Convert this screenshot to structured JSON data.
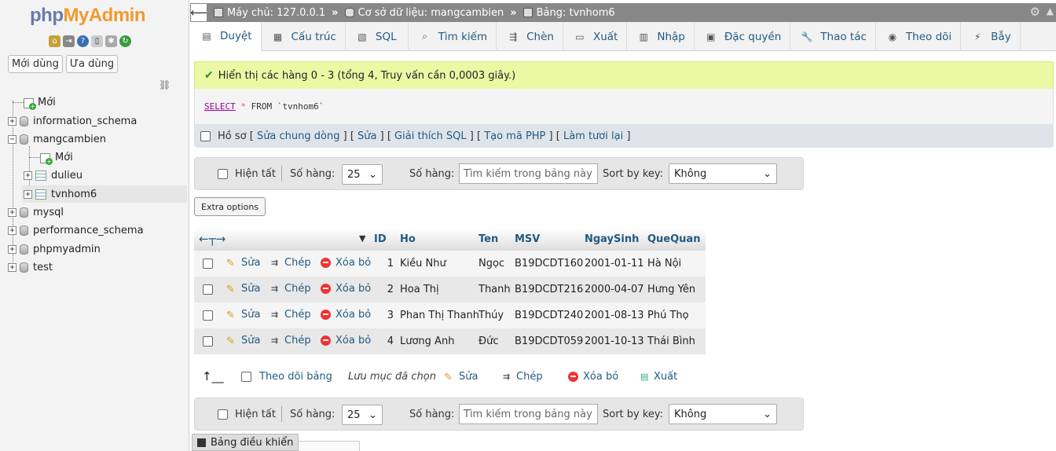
{
  "sidebar": {
    "logo_part1": "php",
    "logo_part2": "MyAdmin",
    "quick_icons": [
      "home-icon",
      "exit-icon",
      "help-icon",
      "docs-icon",
      "settings-icon",
      "reload-icon"
    ],
    "recent_label": "Mới dùng",
    "favorite_label": "Ưa dùng",
    "tree": {
      "new": "Mới",
      "dbs": [
        "information_schema",
        "mangcambien",
        "mysql",
        "performance_schema",
        "phpmyadmin",
        "test"
      ],
      "child_new": "Mới",
      "tables": [
        "dulieu",
        "tvnhom6"
      ]
    }
  },
  "breadcrumb": {
    "server": "Máy chủ: 127.0.0.1",
    "database": "Cơ sở dữ liệu: mangcambien",
    "table": "Bảng: tvnhom6"
  },
  "tabs": [
    {
      "label": "Duyệt",
      "icon": "browse-icon"
    },
    {
      "label": "Cấu trúc",
      "icon": "structure-icon"
    },
    {
      "label": "SQL",
      "icon": "sql-icon"
    },
    {
      "label": "Tìm kiếm",
      "icon": "search-icon"
    },
    {
      "label": "Chèn",
      "icon": "insert-icon"
    },
    {
      "label": "Xuất",
      "icon": "export-icon"
    },
    {
      "label": "Nhập",
      "icon": "import-icon"
    },
    {
      "label": "Đặc quyền",
      "icon": "privileges-icon"
    },
    {
      "label": "Thao tác",
      "icon": "operations-icon"
    },
    {
      "label": "Theo dõi",
      "icon": "tracking-icon"
    },
    {
      "label": "Bẫy",
      "icon": "triggers-icon"
    }
  ],
  "message": "Hiển thị các hàng 0 - 3 (tổng 4, Truy vấn cần 0,0003 giây.)",
  "sql": {
    "kw": "SELECT",
    "star": "*",
    "from": "FROM",
    "table": "`tvnhom6`"
  },
  "profiling": {
    "label": "Hồ sơ",
    "links": [
      "Sửa chung dòng",
      "Sửa",
      "Giải thích SQL",
      "Tạo mã PHP",
      "Làm tươi lại"
    ]
  },
  "nav": {
    "show_all": "Hiện tất",
    "rows_label": "Số hàng:",
    "rows_value": "25",
    "filter_label": "Số hàng:",
    "filter_placeholder": "Tìm kiếm trong bảng này",
    "sort_label": "Sort by key:",
    "sort_value": "Không"
  },
  "extra_options": "Extra options",
  "table": {
    "columns": [
      "ID",
      "Ho",
      "Ten",
      "MSV",
      "NgaySinh",
      "QueQuan"
    ],
    "actions": {
      "edit": "Sửa",
      "copy": "Chép",
      "delete": "Xóa bỏ"
    },
    "rows": [
      {
        "ID": "1",
        "Ho": "Kiều Như",
        "Ten": "Ngọc",
        "MSV": "B19DCDT160",
        "NgaySinh": "2001-01-11",
        "QueQuan": "Hà Nội"
      },
      {
        "ID": "2",
        "Ho": "Hoa Thị",
        "Ten": "Thanh",
        "MSV": "B19DCDT216",
        "NgaySinh": "2000-04-07",
        "QueQuan": "Hưng Yên"
      },
      {
        "ID": "3",
        "Ho": "Phan Thị Thanh",
        "Ten": "Thúy",
        "MSV": "B19DCDT240",
        "NgaySinh": "2001-08-13",
        "QueQuan": "Phú Thọ"
      },
      {
        "ID": "4",
        "Ho": "Lương Anh",
        "Ten": "Đức",
        "MSV": "B19DCDT059",
        "NgaySinh": "2001-10-13",
        "QueQuan": "Thái Bình"
      }
    ]
  },
  "bulk": {
    "track": "Theo dõi bảng",
    "with_selected": "Lưu mục đã chọn",
    "edit": "Sửa",
    "copy": "Chép",
    "delete": "Xóa bỏ",
    "export": "Xuất"
  },
  "console": "Bảng điều khiển"
}
